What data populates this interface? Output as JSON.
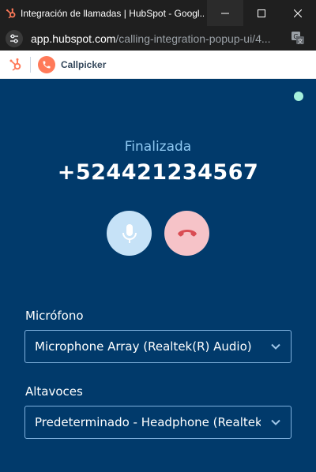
{
  "browser": {
    "window_title": "Integración de llamadas | HubSpot - Googl...",
    "url_domain": "app.hubspot.com",
    "url_path": "/calling-integration-popup-ui/4..."
  },
  "app": {
    "name": "Callpicker"
  },
  "call": {
    "status": "Finalizada",
    "number": "+524421234567"
  },
  "devices": {
    "microphone_label": "Micrófono",
    "microphone_value": "Microphone Array (Realtek(R) Audio)",
    "speakers_label": "Altavoces",
    "speakers_value": "Predeterminado - Headphone (Realtek(R) Audio)"
  },
  "colors": {
    "panel_bg": "#013a6b",
    "status_text": "#8ec8f2",
    "mic_button": "#c6e2f7",
    "hangup_button": "#f6c3c8",
    "status_dot": "#a5f0dc",
    "brand_orange": "#ff7a59"
  },
  "icons": {
    "favicon": "hubspot-sprocket-icon",
    "site_info": "tune-icon",
    "translate": "translate-icon",
    "mic": "microphone-icon",
    "hangup": "phone-hangup-icon",
    "dropdown": "chevron-down-icon"
  }
}
